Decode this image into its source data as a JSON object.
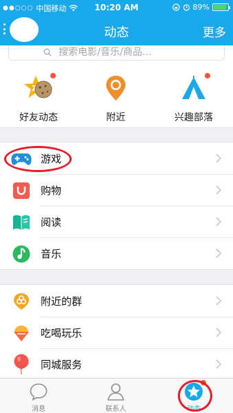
{
  "status_bar": {
    "carrier": "中国移动",
    "time": "10:20 AM",
    "battery": "89%",
    "battery_level": 0.89
  },
  "nav": {
    "title": "动态",
    "more": "更多"
  },
  "search": {
    "placeholder": "搜索电影/音乐/商品..."
  },
  "quick": [
    {
      "label": "好友动态",
      "icon": "friends-feed-icon"
    },
    {
      "label": "附近",
      "icon": "location-pin-icon"
    },
    {
      "label": "兴趣部落",
      "icon": "tent-icon"
    }
  ],
  "sections": [
    {
      "items": [
        {
          "label": "游戏",
          "icon": "gamepad-icon"
        },
        {
          "label": "购物",
          "icon": "shopping-bag-icon"
        },
        {
          "label": "阅读",
          "icon": "book-icon"
        },
        {
          "label": "音乐",
          "icon": "music-note-icon"
        }
      ]
    },
    {
      "items": [
        {
          "label": "附近的群",
          "icon": "nearby-groups-icon"
        },
        {
          "label": "吃喝玩乐",
          "icon": "ice-cream-icon"
        },
        {
          "label": "同城服务",
          "icon": "balloon-icon"
        }
      ]
    }
  ],
  "tabbar": [
    {
      "label": "消息",
      "icon": "message-bubble-icon"
    },
    {
      "label": "联系人",
      "icon": "contacts-icon"
    },
    {
      "label": "动态",
      "icon": "star-icon"
    }
  ],
  "colors": {
    "brand": "#19a9ea",
    "highlight": "#e51d2a",
    "badge": "#f7573c"
  }
}
